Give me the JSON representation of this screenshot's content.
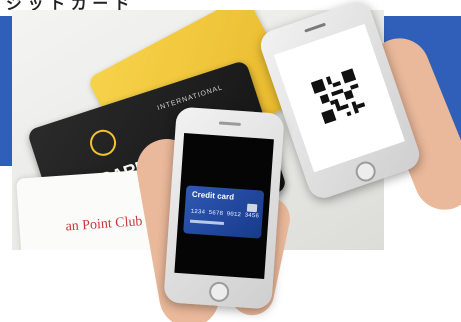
{
  "image": {
    "partial_top_text": "ジ ッ ト  カ ー ド",
    "cards": {
      "yellow_label": "",
      "black_card_label": "INTERNATIONAL",
      "debit_card_text": "EBIO CARD",
      "white_card_text": "an Point Club"
    },
    "phone_left": {
      "card_title": "Credit card",
      "card_number": "1234 5678 9012 3456"
    },
    "phone_right": {
      "content": "qr-code"
    },
    "colors": {
      "blue_band": "#2f5fb8",
      "yellow_card": "#f2c43a",
      "black_card": "#1a1a1a",
      "credit_card_blue": "#2a52ab"
    }
  }
}
